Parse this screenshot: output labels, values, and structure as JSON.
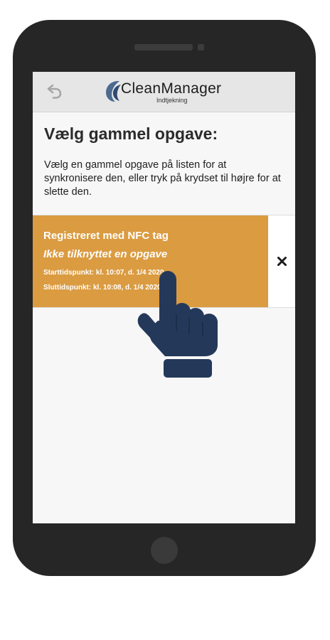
{
  "header": {
    "back_icon": "undo-arrow-icon",
    "logo_name": "CleanManager",
    "logo_subtitle": "Indtjekning"
  },
  "page": {
    "title": "Vælg gammel opgave:",
    "instructions": "Vælg en gammel opgave på listen for at synkronisere den, eller tryk på krydset til højre for at slette den."
  },
  "task": {
    "title": "Registreret med NFC tag",
    "subtitle": "Ikke tilknyttet en opgave",
    "start": "Starttidspunkt: kl. 10:07, d. 1/4 2020",
    "end": "Sluttidspunkt: kl. 10:08, d. 1/4 2020",
    "delete_icon": "close-x-icon"
  },
  "overlay": {
    "hand_icon": "tap-hand-pointer-icon"
  },
  "colors": {
    "phone_body": "#262626",
    "screen_bg": "#f7f7f7",
    "header_bg": "#e6e6e6",
    "task_card_bg": "#db9b41",
    "hand_fill": "#24395a"
  }
}
